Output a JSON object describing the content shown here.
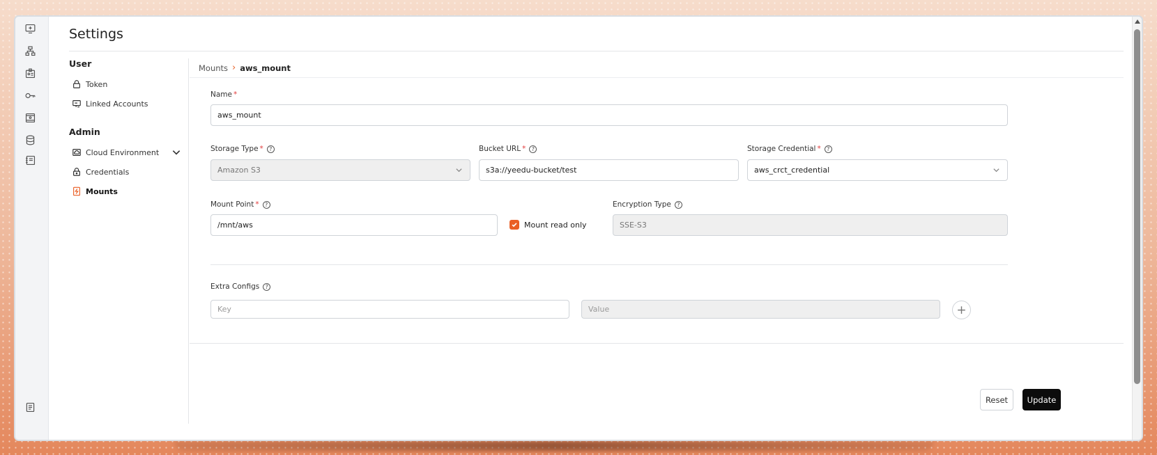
{
  "page": {
    "title": "Settings"
  },
  "sidebar": {
    "user_heading": "User",
    "admin_heading": "Admin",
    "items": [
      {
        "label": "Token",
        "icon": "lock-icon"
      },
      {
        "label": "Linked Accounts",
        "icon": "linked-accounts-icon"
      },
      {
        "label": "Cloud Environment",
        "icon": "cloud-icon"
      },
      {
        "label": "Credentials",
        "icon": "lock-icon"
      },
      {
        "label": "Mounts",
        "icon": "mount-icon",
        "active": true
      }
    ]
  },
  "breadcrumb": {
    "parent": "Mounts",
    "separator": "›",
    "current": "aws_mount"
  },
  "form": {
    "name": {
      "label": "Name",
      "required": "*",
      "value": "aws_mount"
    },
    "storage_type": {
      "label": "Storage Type",
      "required": "*",
      "value": "Amazon S3"
    },
    "bucket_url": {
      "label": "Bucket URL",
      "required": "*",
      "value": "s3a://yeedu-bucket/test"
    },
    "storage_credential": {
      "label": "Storage Credential",
      "required": "*",
      "value": "aws_crct_credential"
    },
    "mount_point": {
      "label": "Mount Point",
      "required": "*",
      "value": "/mnt/aws"
    },
    "mount_read_only": {
      "label": "Mount read only",
      "checked": true
    },
    "encryption_type": {
      "label": "Encryption Type",
      "value": "SSE-S3"
    },
    "extra_configs": {
      "label": "Extra Configs",
      "key_placeholder": "Key",
      "value_placeholder": "Value",
      "add": "+"
    },
    "help": "?"
  },
  "actions": {
    "reset": "Reset",
    "update": "Update"
  },
  "colors": {
    "accent": "#ea5f25",
    "primary_button": "#0c0c0c",
    "required": "#e23b3b"
  }
}
